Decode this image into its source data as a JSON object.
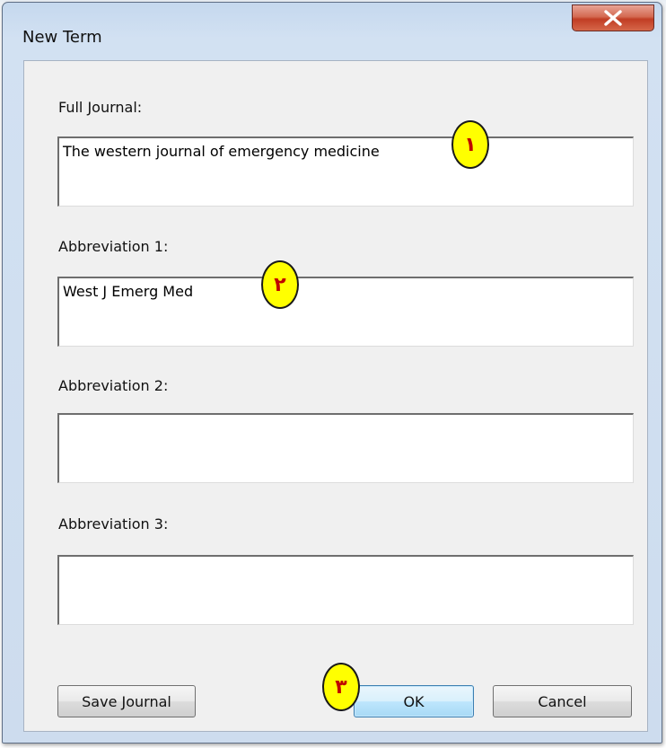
{
  "window": {
    "title": "New Term",
    "close_glyph": "✕"
  },
  "fields": {
    "full_journal": {
      "label": "Full Journal:",
      "value": "The western journal of emergency medicine"
    },
    "abbreviation1": {
      "label": "Abbreviation 1:",
      "value": "West J Emerg Med"
    },
    "abbreviation2": {
      "label": "Abbreviation 2:",
      "value": ""
    },
    "abbreviation3": {
      "label": "Abbreviation 3:",
      "value": ""
    }
  },
  "buttons": {
    "save_journal": "Save Journal",
    "ok": "OK",
    "cancel": "Cancel"
  },
  "markers": {
    "one": "١",
    "two": "٢",
    "three": "٣"
  },
  "colors": {
    "marker_fill": "#ffff00",
    "marker_text": "#c00000",
    "close_button": "#c94a33",
    "ok_button": "#bee6fd"
  }
}
